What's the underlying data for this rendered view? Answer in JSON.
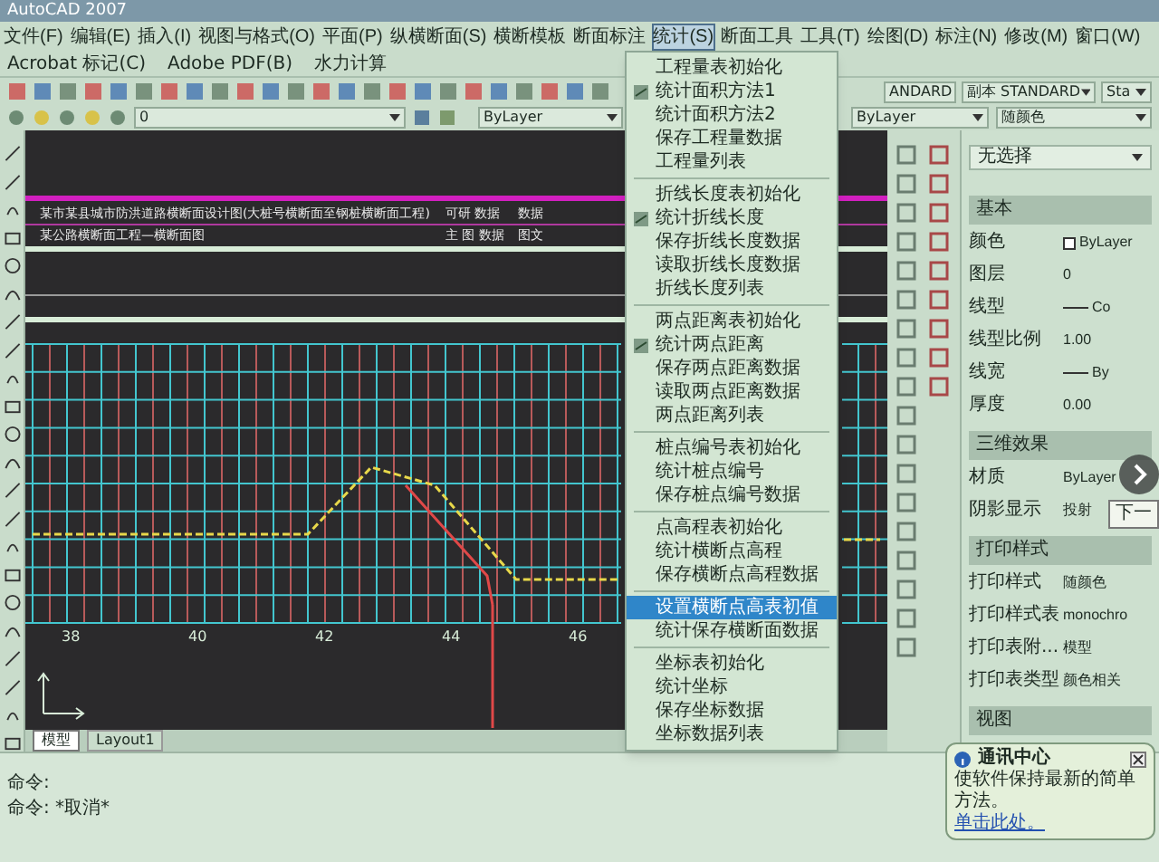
{
  "window": {
    "title": "AutoCAD 2007"
  },
  "menu_bar": [
    {
      "label": "文件(F)",
      "selected": false
    },
    {
      "label": "编辑(E)",
      "selected": false
    },
    {
      "label": "插入(I)",
      "selected": false
    },
    {
      "label": "视图与格式(O)",
      "selected": false
    },
    {
      "label": "平面(P)",
      "selected": false
    },
    {
      "label": "纵横断面(S)",
      "selected": false
    },
    {
      "label": "横断模板",
      "selected": false
    },
    {
      "label": "断面标注",
      "selected": false
    },
    {
      "label": "统计(S)",
      "selected": true
    },
    {
      "label": "断面工具",
      "selected": false
    },
    {
      "label": "工具(T)",
      "selected": false
    },
    {
      "label": "绘图(D)",
      "selected": false
    },
    {
      "label": "标注(N)",
      "selected": false
    },
    {
      "label": "修改(M)",
      "selected": false
    },
    {
      "label": "窗口(W)",
      "selected": false
    }
  ],
  "menu_bar_2": [
    "Acrobat 标记(C)",
    "Adobe PDF(B)",
    "水力计算"
  ],
  "toolbar": {
    "text_style": "ANDARD",
    "dim_style": "副本 STANDARD",
    "table_style": "Sta"
  },
  "layer_toolbar": {
    "layer": "0",
    "color_control": "ByLayer",
    "linetype": "ByLayer",
    "plot_style": "随颜色"
  },
  "drawing": {
    "table_rows": [
      {
        "title": "某市某县城市防洪道路横断面设计图(大桩号横断面至钢桩横断面工程)",
        "cell_1": "可研 数据",
        "cell_2": "数据"
      },
      {
        "title": "某公路横断面工程—横断面图",
        "cell_1": "主 图 数据",
        "cell_2": "图文"
      }
    ],
    "x_labels": [
      "38",
      "40",
      "42",
      "44",
      "46"
    ]
  },
  "layout_tabs": [
    {
      "label": "模型",
      "selected": true
    },
    {
      "label": "Layout1",
      "selected": false
    }
  ],
  "command_lines": [
    "命令:",
    "命令: *取消*"
  ],
  "stats_menu": [
    [
      {
        "label": "工程量表初始化",
        "has_icon": false,
        "selected": false
      },
      {
        "label": "统计面积方法1",
        "has_icon": true,
        "selected": false
      },
      {
        "label": "统计面积方法2",
        "has_icon": false,
        "selected": false
      },
      {
        "label": "保存工程量数据",
        "has_icon": false,
        "selected": false
      },
      {
        "label": "工程量列表",
        "has_icon": false,
        "selected": false
      }
    ],
    [
      {
        "label": "折线长度表初始化",
        "has_icon": false,
        "selected": false
      },
      {
        "label": "统计折线长度",
        "has_icon": true,
        "selected": false
      },
      {
        "label": "保存折线长度数据",
        "has_icon": false,
        "selected": false
      },
      {
        "label": "读取折线长度数据",
        "has_icon": false,
        "selected": false
      },
      {
        "label": "折线长度列表",
        "has_icon": false,
        "selected": false
      }
    ],
    [
      {
        "label": "两点距离表初始化",
        "has_icon": false,
        "selected": false
      },
      {
        "label": "统计两点距离",
        "has_icon": true,
        "selected": false
      },
      {
        "label": "保存两点距离数据",
        "has_icon": false,
        "selected": false
      },
      {
        "label": "读取两点距离数据",
        "has_icon": false,
        "selected": false
      },
      {
        "label": "两点距离列表",
        "has_icon": false,
        "selected": false
      }
    ],
    [
      {
        "label": "桩点编号表初始化",
        "has_icon": false,
        "selected": false
      },
      {
        "label": "统计桩点编号",
        "has_icon": false,
        "selected": false
      },
      {
        "label": "保存桩点编号数据",
        "has_icon": false,
        "selected": false
      }
    ],
    [
      {
        "label": "点高程表初始化",
        "has_icon": false,
        "selected": false
      },
      {
        "label": "统计横断点高程",
        "has_icon": false,
        "selected": false
      },
      {
        "label": "保存横断点高程数据",
        "has_icon": false,
        "selected": false
      }
    ],
    [
      {
        "label": "设置横断点高表初值",
        "has_icon": false,
        "selected": true
      },
      {
        "label": "统计保存横断面数据",
        "has_icon": false,
        "selected": false
      }
    ],
    [
      {
        "label": "坐标表初始化",
        "has_icon": false,
        "selected": false
      },
      {
        "label": "统计坐标",
        "has_icon": false,
        "selected": false
      },
      {
        "label": "保存坐标数据",
        "has_icon": false,
        "selected": false
      },
      {
        "label": "坐标数据列表",
        "has_icon": false,
        "selected": false
      }
    ]
  ],
  "properties": {
    "selector": "无选择",
    "sections": [
      {
        "title": "基本",
        "rows": [
          {
            "name": "颜色",
            "value": "ByLayer",
            "kind": "color"
          },
          {
            "name": "图层",
            "value": "0",
            "kind": "text"
          },
          {
            "name": "线型",
            "value": "Co",
            "kind": "line"
          },
          {
            "name": "线型比例",
            "value": "1.00",
            "kind": "text"
          },
          {
            "name": "线宽",
            "value": "By",
            "kind": "line"
          },
          {
            "name": "厚度",
            "value": "0.00",
            "kind": "text"
          }
        ]
      },
      {
        "title": "三维效果",
        "rows": [
          {
            "name": "材质",
            "value": "ByLayer",
            "kind": "text"
          },
          {
            "name": "阴影显示",
            "value": "投射",
            "kind": "text"
          }
        ]
      },
      {
        "title": "打印样式",
        "rows": [
          {
            "name": "打印样式",
            "value": "随颜色",
            "kind": "text"
          },
          {
            "name": "打印样式表",
            "value": "monochro",
            "kind": "text"
          },
          {
            "name": "打印表附...",
            "value": "模型",
            "kind": "text"
          },
          {
            "name": "打印表类型",
            "value": "颜色相关",
            "kind": "text"
          }
        ]
      },
      {
        "title": "视图"
      }
    ]
  },
  "notification": {
    "title": "通讯中心",
    "message": "使软件保持最新的简单方法。",
    "link": "单击此处。"
  },
  "video_overlay": {
    "tooltip": "下一"
  }
}
